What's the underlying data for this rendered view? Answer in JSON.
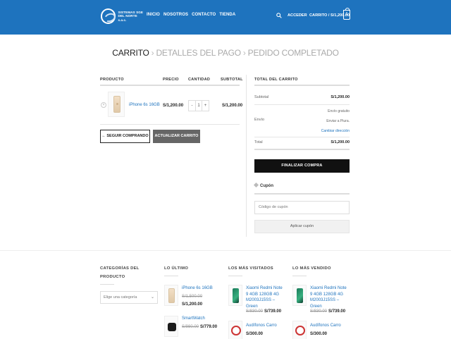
{
  "header": {
    "logo_line1": "SISTEMAS SGE",
    "logo_line2": "DEL NORTE s.a.c.",
    "nav": [
      "INICIO",
      "NOSOTROS",
      "CONTACTO",
      "TIENDA"
    ],
    "account_label": "ACCEDER",
    "cart_label": "CARRITO / S/1,200.00",
    "cart_count": "1",
    "bg_color": "#1e73be"
  },
  "steps": {
    "step1": "CARRITO",
    "step2": "DETALLES DEL PAGO",
    "step3": "PEDIDO COMPLETADO"
  },
  "cart": {
    "headers": {
      "product": "PRODUCTO",
      "price": "PRECIO",
      "quantity": "CANTIDAD",
      "subtotal": "SUBTOTAL"
    },
    "items": [
      {
        "name": "iPhone 6s 16GB",
        "price": "S/1,200.00",
        "quantity": "1",
        "subtotal": "S/1,200.00"
      }
    ],
    "qty_minus": "-",
    "qty_plus": "+",
    "remove_symbol": "×",
    "continue_label": "← SEGUIR COMPRANDO",
    "update_label": "ACTUALIZAR CARRITO"
  },
  "totals": {
    "title": "TOTAL DEL CARRITO",
    "subtotal_label": "Subtotal",
    "subtotal_value": "S/1,200.00",
    "shipping_label": "Envío",
    "shipping_free": "Envío gratuito",
    "shipping_to": "Enviar a Piura.",
    "change_address": "Cambiar dirección",
    "total_label": "Total",
    "total_value": "S/1,200.00",
    "checkout_label": "FINALIZAR COMPRA"
  },
  "coupon": {
    "title": "Cupón",
    "placeholder": "Código de cupón",
    "apply_label": "Aplicar cupón"
  },
  "footer": {
    "categories": {
      "title_line1": "CATEGORÍAS DEL",
      "title_line2": "PRODUCTO",
      "select_value": "Elige una categoría"
    },
    "latest": {
      "title": "LO ÚLTIMO",
      "items": [
        {
          "name": "iPhone 6s 16GB",
          "old_price": "S/1,500.00",
          "price": "S/1,200.00"
        },
        {
          "name": "SmartWatch",
          "old_price": "S/980.00",
          "price": "S/779.00"
        }
      ]
    },
    "most_viewed": {
      "title": "LOS MÁS VISITADOS",
      "items": [
        {
          "name": "Xiaomi Redmi Note 9 4GB 128GB 4G M2003J15SS – Green",
          "old_price": "S/830.00",
          "price": "S/739.00"
        },
        {
          "name": "Audífonos Carro",
          "price": "S/300.00"
        }
      ]
    },
    "best_sellers": {
      "title": "LO MÁS VENDIDO",
      "items": [
        {
          "name": "Xiaomi Redmi Note 9 4GB 128GB 4G M2003J15SS – Green",
          "old_price": "S/830.00",
          "price": "S/739.00"
        },
        {
          "name": "Audífonos Carro",
          "price": "S/300.00"
        }
      ]
    }
  }
}
